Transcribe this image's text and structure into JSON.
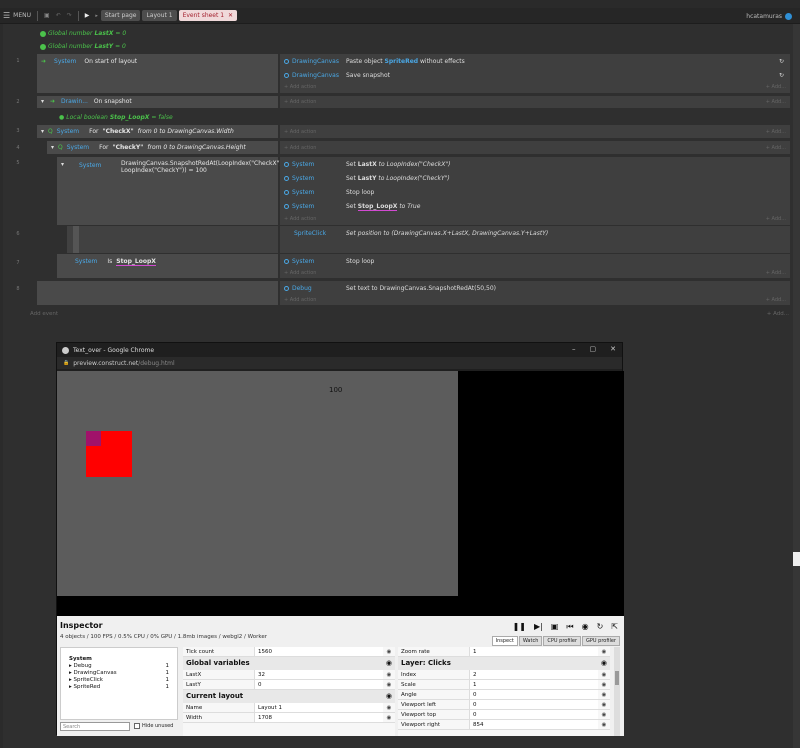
{
  "menubar": {
    "menu_label": "MENU",
    "tabs": [
      {
        "label": "Start page",
        "active": false
      },
      {
        "label": "Layout 1",
        "active": false
      },
      {
        "label": "Event sheet 1",
        "active": true
      }
    ],
    "close_glyph": "✕",
    "username": "hcatamuras"
  },
  "globals": [
    {
      "text": "Global number",
      "name": "LastX",
      "value": "= 0"
    },
    {
      "text": "Global number",
      "name": "LastY",
      "value": "= 0"
    }
  ],
  "events": {
    "e1": {
      "num": "1",
      "object": "System",
      "condition": "On start of layout",
      "actions": [
        {
          "object": "DrawingCanvas",
          "text_pre": "Paste object",
          "text_obj": "SpriteRed",
          "text_post": "without effects"
        },
        {
          "object": "DrawingCanvas",
          "text_pre": "Save snapshot",
          "text_obj": "",
          "text_post": ""
        }
      ]
    },
    "e2": {
      "num": "2",
      "object": "Drawin...",
      "condition": "On snapshot"
    },
    "local": {
      "text": "Local boolean",
      "name": "Stop_LoopX",
      "value": "= false"
    },
    "e3": {
      "num": "3",
      "object": "System",
      "condition_pre": "For",
      "var": "\"CheckX\"",
      "condition_post": "from 0 to DrawingCanvas.Width"
    },
    "e4": {
      "num": "4",
      "object": "System",
      "condition_pre": "For",
      "var": "\"CheckY\"",
      "condition_post": "from 0 to DrawingCanvas.Height"
    },
    "e5": {
      "num": "5",
      "object": "System",
      "condition": "DrawingCanvas.SnapshotRedAt(LoopIndex(\"CheckX\"), LoopIndex(\"CheckY\")) = 100",
      "actions": [
        {
          "object": "System",
          "pre": "Set",
          "var": "LastX",
          "post": "to LoopIndex(\"CheckX\")"
        },
        {
          "object": "System",
          "pre": "Set",
          "var": "LastY",
          "post": "to LoopIndex(\"CheckY\")"
        },
        {
          "object": "System",
          "pre": "Stop loop",
          "var": "",
          "post": ""
        },
        {
          "object": "System",
          "pre": "Set",
          "var": "Stop_LoopX",
          "post": "to True"
        }
      ]
    },
    "e6": {
      "num": "6",
      "action_object": "SpriteClick",
      "action": "Set position to (DrawingCanvas.X+LastX, DrawingCanvas.Y+LastY)"
    },
    "e7": {
      "num": "7",
      "object": "System",
      "condition_pre": "Is",
      "var": "Stop_LoopX",
      "action_object": "System",
      "action": "Stop loop"
    },
    "e8": {
      "num": "8",
      "action_object": "Debug",
      "action": "Set text to DrawingCanvas.SnapshotRedAt(50,50)"
    },
    "add_action": "+ Add action",
    "add_event": "Add event",
    "add_right": "+ Add..."
  },
  "chrome": {
    "title": "Text_over - Google Chrome",
    "url_host": "preview.construct.net",
    "url_path": "/debug.html",
    "controls": [
      "–",
      "▢",
      "✕"
    ],
    "canvas_text": "100"
  },
  "inspector": {
    "title": "Inspector",
    "stats": "4 objects / 100 FPS / 0.5% CPU / 0% GPU / 1.8mb images / webgl2 / Worker",
    "tabs": [
      "Inspect",
      "Watch",
      "CPU profiler",
      "GPU profiler"
    ],
    "tree": [
      {
        "label": "System",
        "count": ""
      },
      {
        "label": "▸ Debug",
        "count": "1"
      },
      {
        "label": "▸ DrawingCanvas",
        "count": "1"
      },
      {
        "label": "▸ SpriteClick",
        "count": "1"
      },
      {
        "label": "▸ SpriteRed",
        "count": "1"
      }
    ],
    "search_placeholder": "Search",
    "hide_unused": "Hide unused",
    "mid": {
      "top_row": {
        "k": "Tick count",
        "v": "1560"
      },
      "globals_head": "Global variables",
      "globals": [
        {
          "k": "LastX",
          "v": "32"
        },
        {
          "k": "LastY",
          "v": "0"
        }
      ],
      "layout_head": "Current layout",
      "layout": [
        {
          "k": "Name",
          "v": "Layout 1"
        },
        {
          "k": "Width",
          "v": "1708"
        }
      ]
    },
    "right": {
      "top_row": {
        "k": "Zoom rate",
        "v": "1"
      },
      "layer_head": "Layer: Clicks",
      "rows": [
        {
          "k": "Index",
          "v": "2"
        },
        {
          "k": "Scale",
          "v": "1"
        },
        {
          "k": "Angle",
          "v": "0"
        },
        {
          "k": "Viewport left",
          "v": "0"
        },
        {
          "k": "Viewport top",
          "v": "0"
        },
        {
          "k": "Viewport right",
          "v": "854"
        }
      ]
    }
  }
}
